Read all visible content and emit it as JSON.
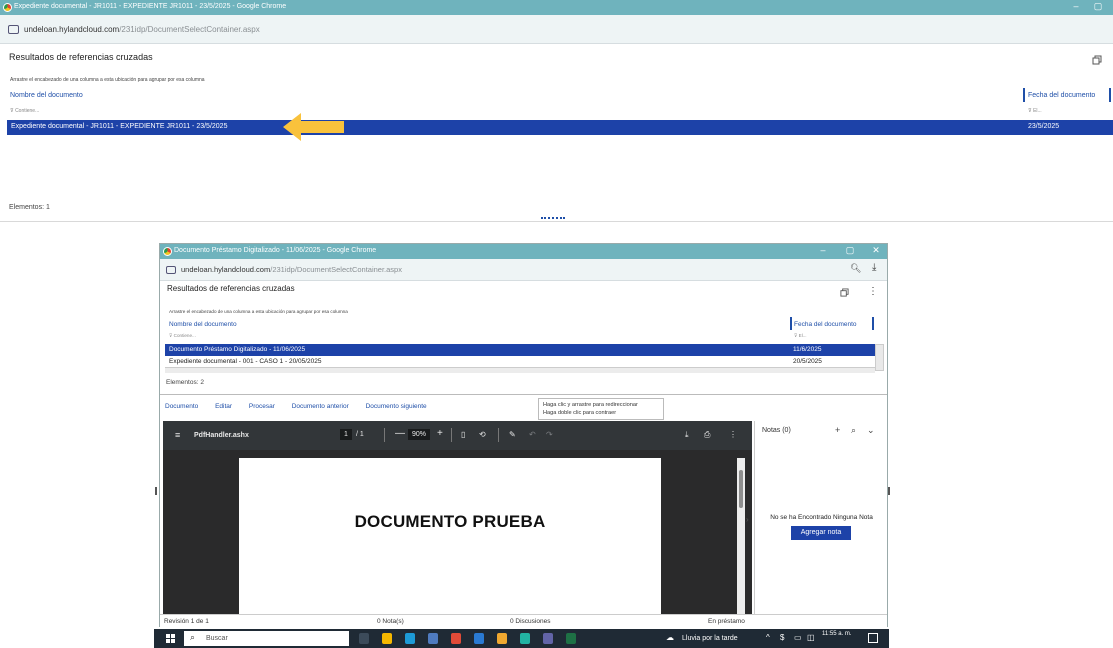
{
  "window_top": {
    "title": "Expediente documental - JR1011 - EXPEDIENTE JR1011 - 23/5/2025 - Google Chrome",
    "url_host": "undeloan.hylandcloud.com",
    "url_path": "/231idp/DocumentSelectContainer.aspx",
    "panel_title": "Resultados de referencias cruzadas",
    "group_hint": "Arrastre el encabezado de una columna a esta ubicación para agrupar por esa columna",
    "columns": {
      "name": "Nombre del documento",
      "date": "Fecha del documento"
    },
    "filters": {
      "name": "Contiene...",
      "date": "El..."
    },
    "rows": [
      {
        "name": "Expediente documental - JR1011 - EXPEDIENTE JR1011 - 23/5/2025",
        "date": "23/5/2025",
        "selected": true
      }
    ],
    "count_label": "Elementos: 1",
    "annotation": {
      "type": "arrow",
      "color": "#f9c23c",
      "direction": "left"
    }
  },
  "window_bottom": {
    "title": "Documento Préstamo Digitalizado - 11/06/2025 - Google Chrome",
    "url_host": "undeloan.hylandcloud.com",
    "url_path": "/231idp/DocumentSelectContainer.aspx",
    "panel_title": "Resultados de referencias cruzadas",
    "group_hint": "Arrastre el encabezado de una columna a esta ubicación para agrupar por esa columna",
    "columns": {
      "name": "Nombre del documento",
      "date": "Fecha del documento"
    },
    "filters": {
      "name": "Contiene...",
      "date": "El..."
    },
    "rows": [
      {
        "name": "Documento Préstamo Digitalizado - 11/06/2025",
        "date": "11/6/2025",
        "selected": true
      },
      {
        "name": "Expediente documental - 001 - CASO 1 - 20/05/2025",
        "date": "20/5/2025",
        "selected": false
      }
    ],
    "count_label": "Elementos: 2",
    "actions": [
      "Documento",
      "Editar",
      "Procesar",
      "Documento anterior",
      "Documento siguiente"
    ],
    "tooltip": {
      "line1": "Haga clic y arrastre para redireccionar",
      "line2": "Haga doble clic para contraer"
    },
    "pdf": {
      "filename": "PdfHandler.ashx",
      "page_current": "1",
      "page_total": "/ 1",
      "zoom": "90%",
      "document_text": "DOCUMENTO PRUEBA"
    },
    "notes": {
      "title": "Notas (0)",
      "empty_message": "No se ha Encontrado Ninguna Nota",
      "add_button": "Agregar nota"
    },
    "status": {
      "revision": "Revisión 1 de 1",
      "notes": "0 Nota(s)",
      "discussions": "0 Discusiones",
      "state": "En préstamo"
    }
  },
  "taskbar": {
    "search_placeholder": "Buscar",
    "weather": "Lluvia por la tarde",
    "time": "11:55 a. m."
  },
  "colors": {
    "titlebar": "#6fb3bd",
    "selection": "#1d42a8",
    "link": "#1f4fa8",
    "pdf_toolbar": "#323639",
    "taskbar": "#1f2a35"
  }
}
